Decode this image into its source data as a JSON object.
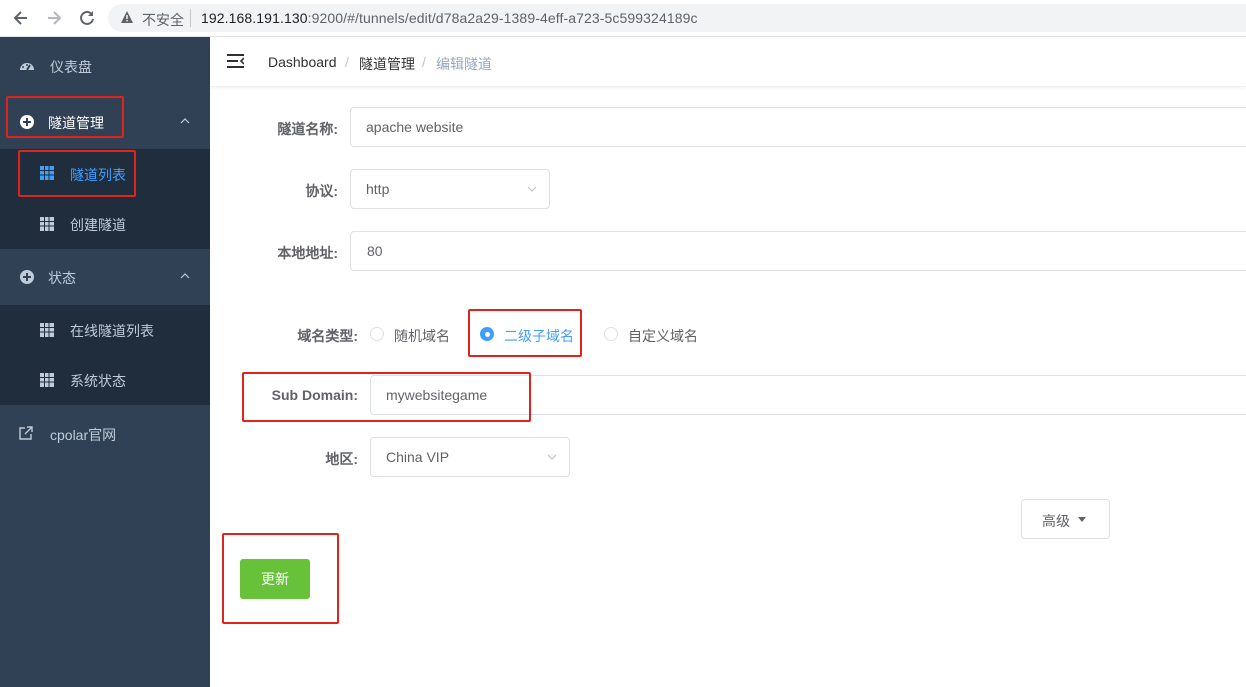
{
  "browser": {
    "back_icon": "arrow-left-icon",
    "forward_icon": "arrow-right-icon",
    "reload_icon": "reload-icon",
    "security_label": "不安全",
    "url_host": "192.168.191.130",
    "url_rest": ":9200/#/tunnels/edit/d78a2a29-1389-4eff-a723-5c599324189c"
  },
  "sidebar": {
    "items": [
      {
        "label": "仪表盘",
        "icon": "dashboard-icon"
      },
      {
        "label": "隧道管理",
        "icon": "circle-plus-icon"
      },
      {
        "label": "隧道列表",
        "icon": "grid-icon"
      },
      {
        "label": "创建隧道",
        "icon": "grid-icon"
      },
      {
        "label": "状态",
        "icon": "circle-plus-icon"
      },
      {
        "label": "在线隧道列表",
        "icon": "grid-icon"
      },
      {
        "label": "系统状态",
        "icon": "grid-icon"
      },
      {
        "label": "cpolar官网",
        "icon": "external-link-icon"
      }
    ]
  },
  "breadcrumb": {
    "items": [
      "Dashboard",
      "隧道管理",
      "编辑隧道"
    ],
    "separator": "/"
  },
  "form": {
    "name_label": "隧道名称:",
    "name_value": "apache website",
    "protocol_label": "协议:",
    "protocol_value": "http",
    "local_label": "本地地址:",
    "local_value": "80",
    "domain_type_label": "域名类型:",
    "domain_options": [
      "随机域名",
      "二级子域名",
      "自定义域名"
    ],
    "domain_selected": "二级子域名",
    "subdomain_label": "Sub Domain:",
    "subdomain_value": "mywebsitegame",
    "region_label": "地区:",
    "region_value": "China VIP",
    "advanced_label": "高级",
    "update_label": "更新"
  },
  "colors": {
    "sidebar_bg": "#304156",
    "sidebar_sub_bg": "#1f2d3d",
    "accent": "#409eff",
    "success": "#67c23a",
    "highlight_box": "#e0231d"
  }
}
